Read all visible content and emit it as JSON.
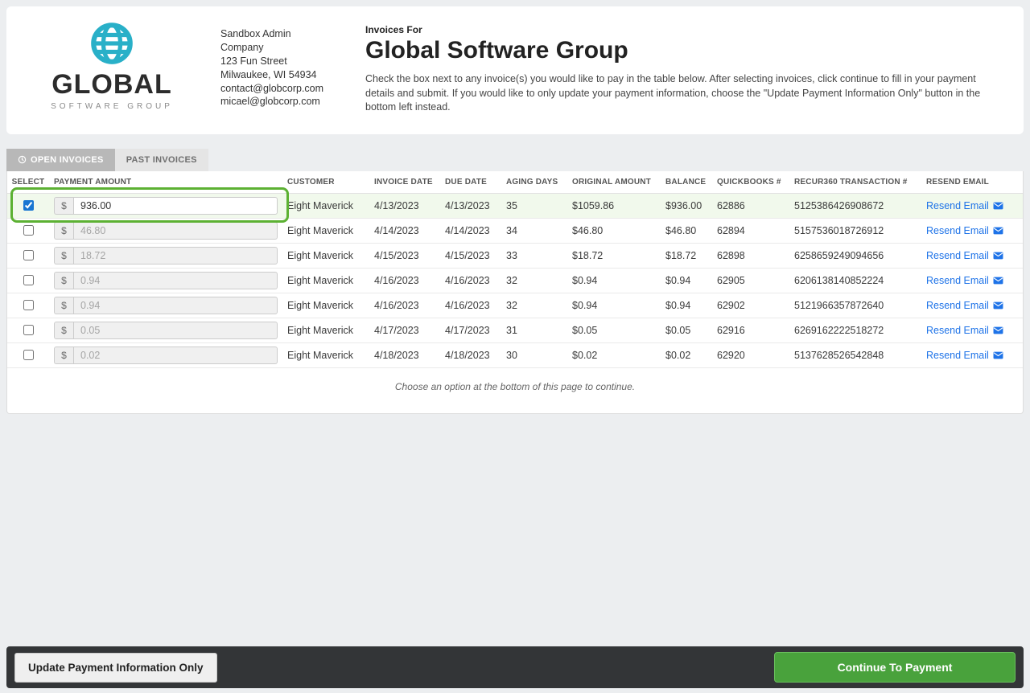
{
  "logo": {
    "word": "GLOBAL",
    "sub": "SOFTWARE GROUP"
  },
  "company": {
    "name": "Sandbox Admin",
    "line2": "Company",
    "address1": "123 Fun Street",
    "address2": "Milwaukee, WI 54934",
    "email": "contact@globcorp.com",
    "contact_email": "micael@globcorp.com"
  },
  "header": {
    "invoices_for_label": "Invoices For",
    "title": "Global Software Group",
    "instructions": "Check the box next to any invoice(s) you would like to pay in the table below. After selecting invoices, click continue to fill in your payment details and submit. If you would like to only update your payment information, choose the \"Update Payment Information Only\" button in the bottom left instead."
  },
  "tabs": {
    "open": "OPEN INVOICES",
    "past": "PAST INVOICES"
  },
  "columns": {
    "select": "SELECT",
    "payment_amount": "PAYMENT AMOUNT",
    "customer": "CUSTOMER",
    "invoice_date": "INVOICE DATE",
    "due_date": "DUE DATE",
    "aging_days": "AGING DAYS",
    "original_amount": "ORIGINAL AMOUNT",
    "balance": "BALANCE",
    "quickbooks": "QUICKBOOKS #",
    "recur": "RECUR360 TRANSACTION #",
    "resend": "RESEND EMAIL"
  },
  "currency_symbol": "$",
  "resend_label": "Resend Email",
  "rows": [
    {
      "selected": true,
      "amount": "936.00",
      "customer": "Eight Maverick",
      "invoice_date": "4/13/2023",
      "due_date": "4/13/2023",
      "aging": "35",
      "original": "$1059.86",
      "balance": "$936.00",
      "qb": "62886",
      "recur": "5125386426908672"
    },
    {
      "selected": false,
      "amount": "46.80",
      "customer": "Eight Maverick",
      "invoice_date": "4/14/2023",
      "due_date": "4/14/2023",
      "aging": "34",
      "original": "$46.80",
      "balance": "$46.80",
      "qb": "62894",
      "recur": "5157536018726912"
    },
    {
      "selected": false,
      "amount": "18.72",
      "customer": "Eight Maverick",
      "invoice_date": "4/15/2023",
      "due_date": "4/15/2023",
      "aging": "33",
      "original": "$18.72",
      "balance": "$18.72",
      "qb": "62898",
      "recur": "6258659249094656"
    },
    {
      "selected": false,
      "amount": "0.94",
      "customer": "Eight Maverick",
      "invoice_date": "4/16/2023",
      "due_date": "4/16/2023",
      "aging": "32",
      "original": "$0.94",
      "balance": "$0.94",
      "qb": "62905",
      "recur": "6206138140852224"
    },
    {
      "selected": false,
      "amount": "0.94",
      "customer": "Eight Maverick",
      "invoice_date": "4/16/2023",
      "due_date": "4/16/2023",
      "aging": "32",
      "original": "$0.94",
      "balance": "$0.94",
      "qb": "62902",
      "recur": "5121966357872640"
    },
    {
      "selected": false,
      "amount": "0.05",
      "customer": "Eight Maverick",
      "invoice_date": "4/17/2023",
      "due_date": "4/17/2023",
      "aging": "31",
      "original": "$0.05",
      "balance": "$0.05",
      "qb": "62916",
      "recur": "6269162222518272"
    },
    {
      "selected": false,
      "amount": "0.02",
      "customer": "Eight Maverick",
      "invoice_date": "4/18/2023",
      "due_date": "4/18/2023",
      "aging": "30",
      "original": "$0.02",
      "balance": "$0.02",
      "qb": "62920",
      "recur": "5137628526542848"
    }
  ],
  "hint": "Choose an option at the bottom of this page to continue.",
  "footer": {
    "update_label": "Update Payment Information Only",
    "continue_label": "Continue To Payment"
  }
}
